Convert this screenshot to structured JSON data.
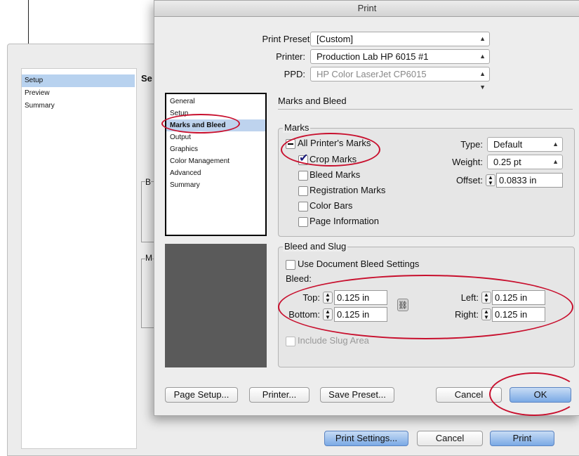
{
  "window": {
    "title": "Print"
  },
  "background": {
    "sidebar_items": [
      "Setup",
      "Preview",
      "Summary"
    ],
    "fragments": [
      "Se",
      "B",
      "M"
    ],
    "buttons": {
      "print_settings": "Print Settings...",
      "cancel": "Cancel",
      "print": "Print"
    }
  },
  "preset": {
    "print_preset_label": "Print Preset:",
    "print_preset_value": "[Custom]",
    "printer_label": "Printer:",
    "printer_value": "Production Lab HP 6015 #1",
    "ppd_label": "PPD:",
    "ppd_value": "HP Color LaserJet CP6015"
  },
  "categories": [
    "General",
    "Setup",
    "Marks and Bleed",
    "Output",
    "Graphics",
    "Color Management",
    "Advanced",
    "Summary"
  ],
  "selected_category": "Marks and Bleed",
  "panel": {
    "title": "Marks and Bleed"
  },
  "marks": {
    "group_title": "Marks",
    "all_printers_marks": "All Printer's Marks",
    "crop_marks": "Crop Marks",
    "bleed_marks": "Bleed Marks",
    "registration_marks": "Registration Marks",
    "color_bars": "Color Bars",
    "page_information": "Page Information",
    "type_label": "Type:",
    "type_value": "Default",
    "weight_label": "Weight:",
    "weight_value": "0.25 pt",
    "offset_label": "Offset:",
    "offset_value": "0.0833 in"
  },
  "bleed": {
    "group_title": "Bleed and Slug",
    "use_document": "Use Document Bleed Settings",
    "bleed_label": "Bleed:",
    "top_label": "Top:",
    "top_value": "0.125 in",
    "bottom_label": "Bottom:",
    "bottom_value": "0.125 in",
    "left_label": "Left:",
    "left_value": "0.125 in",
    "right_label": "Right:",
    "right_value": "0.125 in",
    "include_slug": "Include Slug Area"
  },
  "buttons": {
    "page_setup": "Page Setup...",
    "printer": "Printer...",
    "save_preset": "Save Preset...",
    "cancel": "Cancel",
    "ok": "OK"
  },
  "icons": [
    "link-icon",
    "checkmark-icon",
    "dash-icon",
    "stepper-icon",
    "popup-arrows-icon"
  ],
  "colors": {
    "selection": "#bed3ee",
    "ok_button": "#7aa9e5",
    "annotation": "#c8102e"
  }
}
